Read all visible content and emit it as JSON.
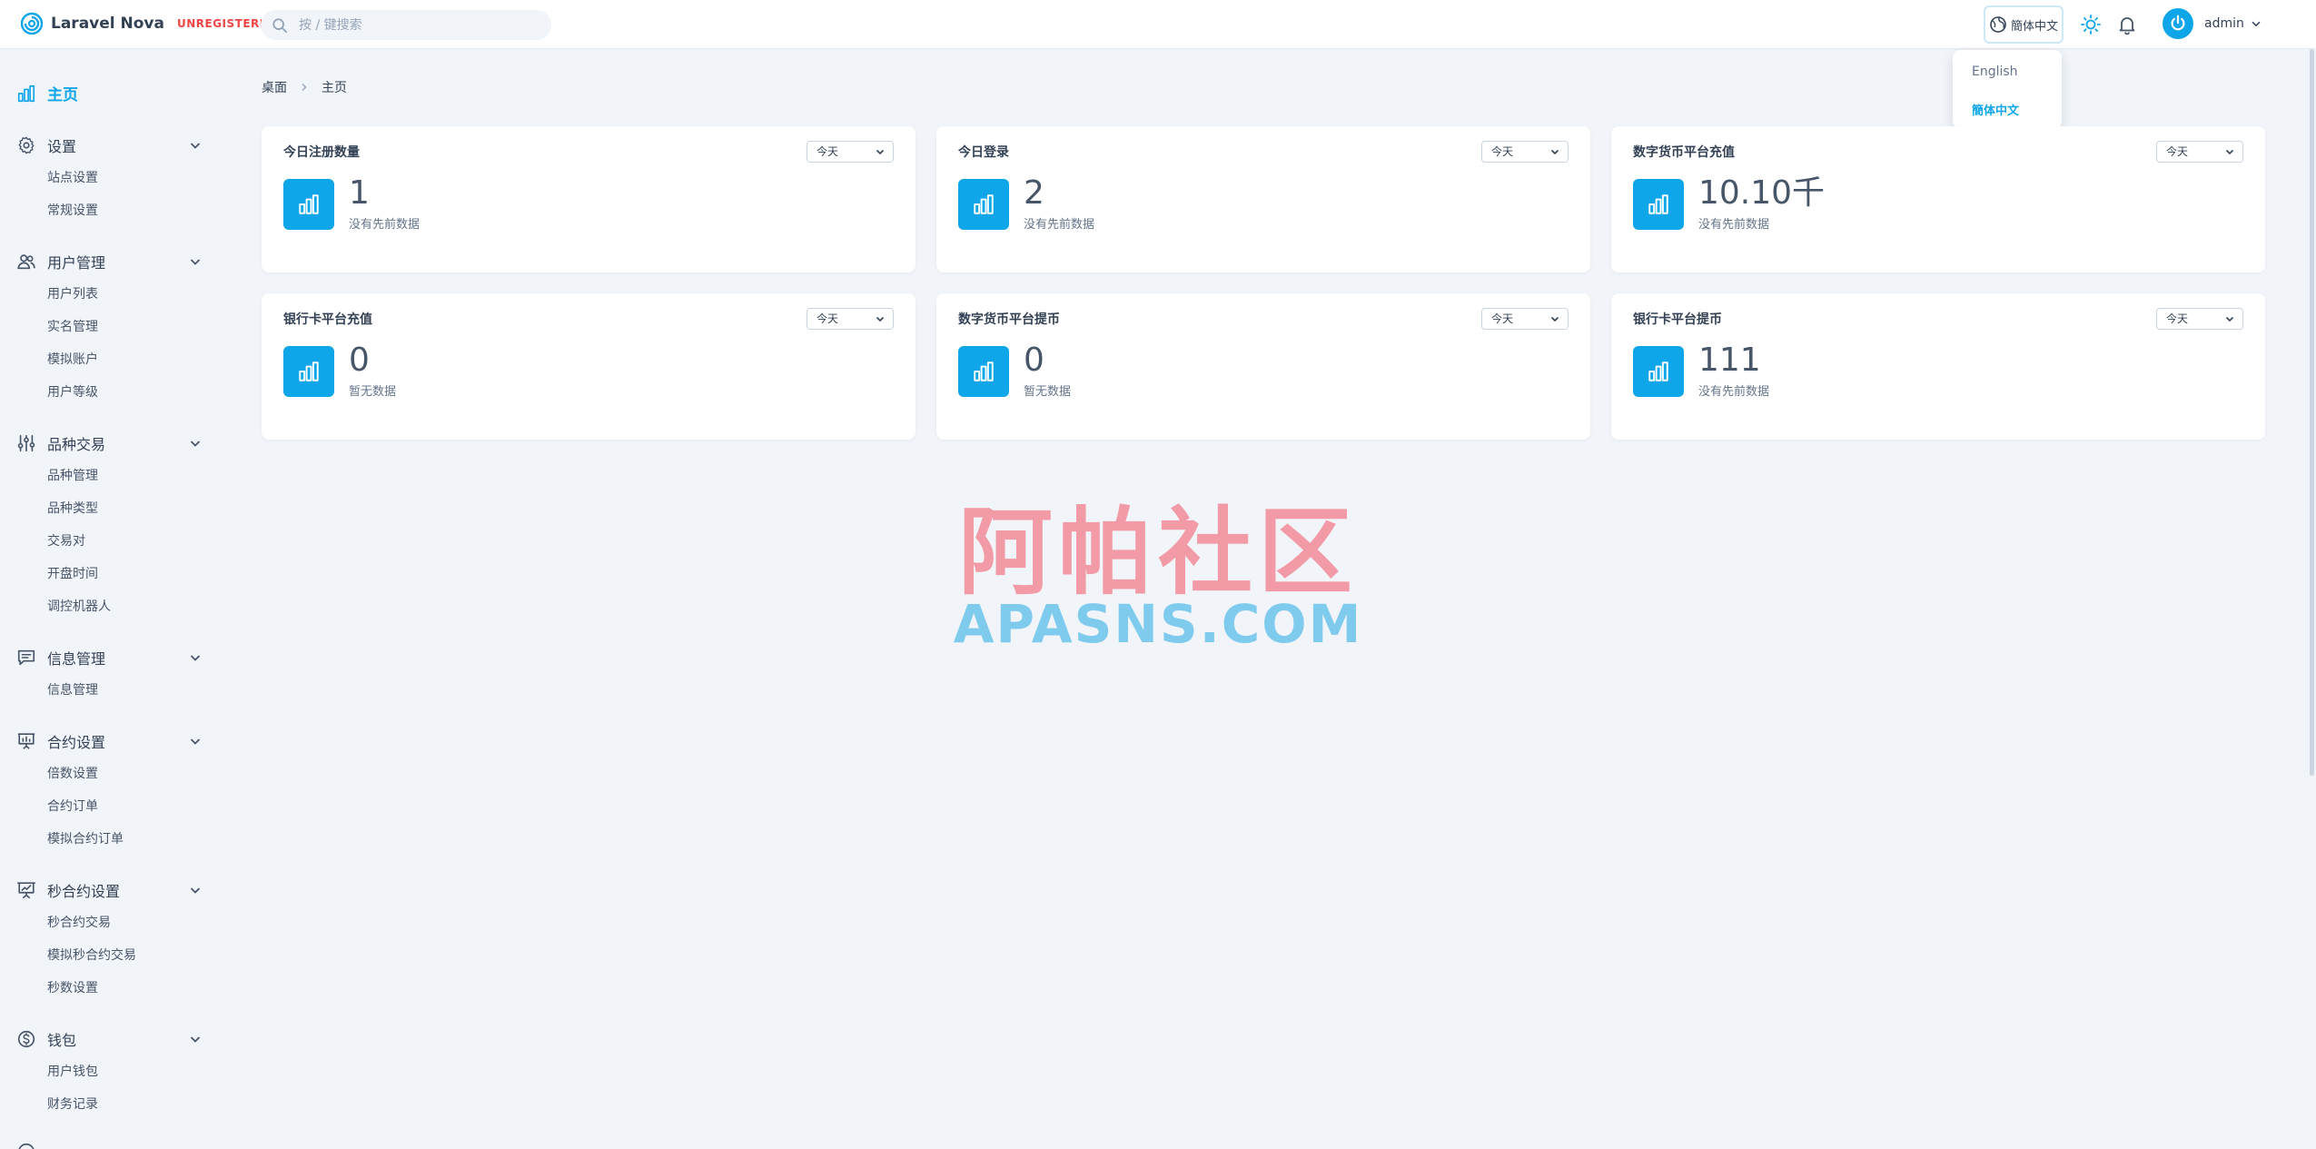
{
  "header": {
    "brand": "Laravel Nova",
    "badge": "UNREGISTERED",
    "search_placeholder": "按 / 键搜索",
    "lang_button": "簡体中文",
    "user_name": "admin"
  },
  "lang_menu": {
    "options": [
      "English",
      "簡体中文"
    ],
    "active": "簡体中文"
  },
  "sidebar": {
    "home": "主页",
    "groups": [
      {
        "label": "设置",
        "items": [
          "站点设置",
          "常规设置"
        ]
      },
      {
        "label": "用户管理",
        "items": [
          "用户列表",
          "实名管理",
          "模拟账户",
          "用户等级"
        ]
      },
      {
        "label": "品种交易",
        "items": [
          "品种管理",
          "品种类型",
          "交易对",
          "开盘时间",
          "调控机器人"
        ]
      },
      {
        "label": "信息管理",
        "items": [
          "信息管理"
        ]
      },
      {
        "label": "合约设置",
        "items": [
          "倍数设置",
          "合约订单",
          "模拟合约订单"
        ]
      },
      {
        "label": "秒合约设置",
        "items": [
          "秒合约交易",
          "模拟秒合约交易",
          "秒数设置"
        ]
      },
      {
        "label": "钱包",
        "items": [
          "用户钱包",
          "财务记录"
        ]
      }
    ]
  },
  "breadcrumb": [
    "桌面",
    "主页"
  ],
  "cards": [
    {
      "title": "今日注册数量",
      "range": "今天",
      "value": "1",
      "note": "没有先前数据"
    },
    {
      "title": "今日登录",
      "range": "今天",
      "value": "2",
      "note": "没有先前数据"
    },
    {
      "title": "数字货币平台充值",
      "range": "今天",
      "value": "10.10千",
      "note": "没有先前数据"
    },
    {
      "title": "银行卡平台充值",
      "range": "今天",
      "value": "0",
      "note": "暂无数据"
    },
    {
      "title": "数字货币平台提币",
      "range": "今天",
      "value": "0",
      "note": "暂无数据"
    },
    {
      "title": "银行卡平台提币",
      "range": "今天",
      "value": "111",
      "note": "没有先前数据"
    }
  ],
  "watermark": {
    "cn": "阿帕社区",
    "en": "APASNS.COM"
  },
  "colors": {
    "accent": "#0ea5e9",
    "background": "#f1f5f9",
    "badge": "#ef4444"
  }
}
